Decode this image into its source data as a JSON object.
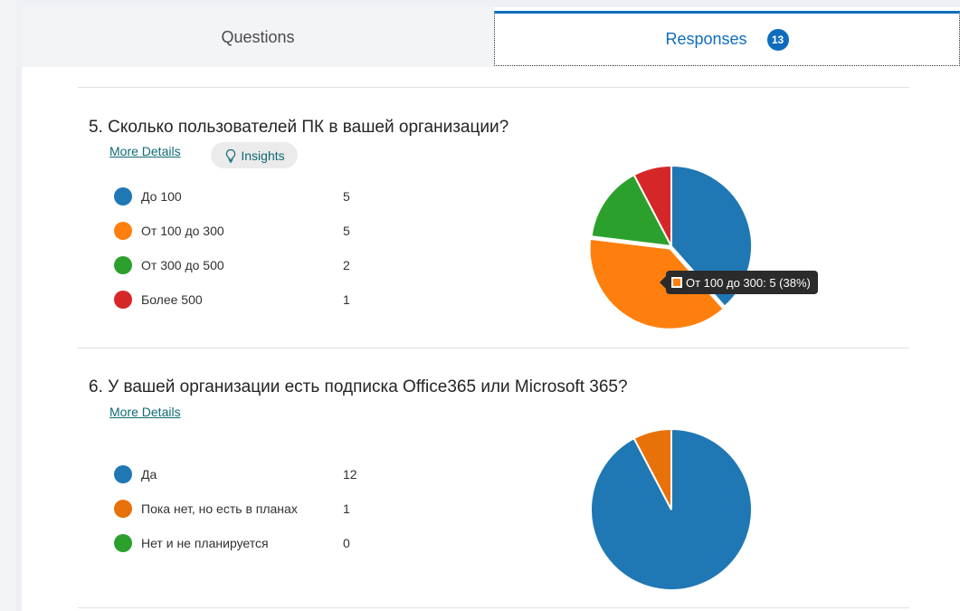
{
  "tabs": {
    "questions_label": "Questions",
    "responses_label": "Responses",
    "responses_count": "13"
  },
  "questions": [
    {
      "number_title": "5.  Сколько пользователей ПК в вашей организации?",
      "more_details": "More Details",
      "insights_label": "Insights",
      "legend": [
        {
          "label": "До 100",
          "count": "5",
          "color": "#1f77b4"
        },
        {
          "label": "От 100 до 300",
          "count": "5",
          "color": "#ff7f0e"
        },
        {
          "label": "От 300 до 500",
          "count": "2",
          "color": "#2ca02c"
        },
        {
          "label": "Более 500",
          "count": "1",
          "color": "#d62728"
        }
      ],
      "tooltip": "От 100 до 300: 5 (38%)"
    },
    {
      "number_title": "6.  У вашей организации есть подписка Office365 или Microsoft 365?",
      "more_details": "More Details",
      "legend": [
        {
          "label": "Да",
          "count": "12",
          "color": "#1f77b4"
        },
        {
          "label": "Пока нет, но есть в планах",
          "count": "1",
          "color": "#e8710a"
        },
        {
          "label": "Нет и не планируется",
          "count": "0",
          "color": "#2ca02c"
        }
      ]
    }
  ],
  "chart_data": [
    {
      "type": "pie",
      "categories": [
        "До 100",
        "От 100 до 300",
        "От 300 до 500",
        "Более 500"
      ],
      "values": [
        5,
        5,
        2,
        1
      ],
      "colors": [
        "#1f77b4",
        "#ff7f0e",
        "#2ca02c",
        "#d62728"
      ],
      "highlighted": "От 100 до 300"
    },
    {
      "type": "pie",
      "categories": [
        "Да",
        "Пока нет, но есть в планах",
        "Нет и не планируется"
      ],
      "values": [
        12,
        1,
        0
      ],
      "colors": [
        "#1f77b4",
        "#e8710a",
        "#2ca02c"
      ]
    }
  ]
}
